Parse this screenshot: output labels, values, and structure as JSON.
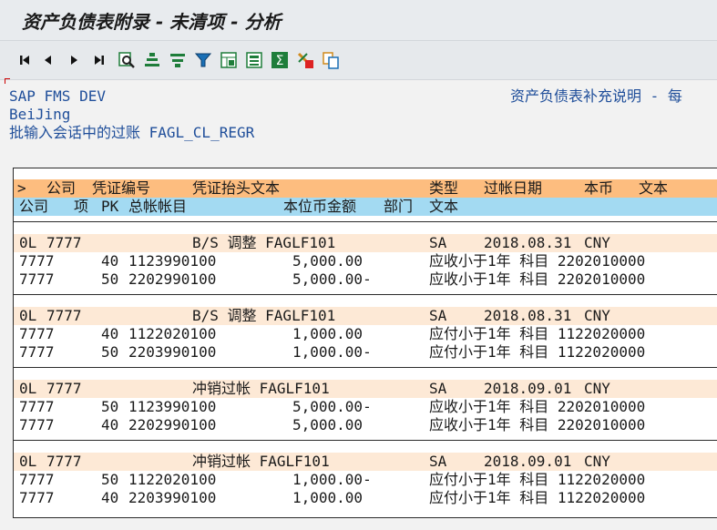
{
  "window": {
    "title": "资产负债表附录 - 未清项 - 分析"
  },
  "toolbar": {
    "buttons": [
      {
        "icon": "first-page-icon",
        "label": ""
      },
      {
        "icon": "previous-page-icon",
        "label": ""
      },
      {
        "icon": "next-page-icon",
        "label": ""
      },
      {
        "icon": "last-page-icon",
        "label": ""
      },
      {
        "icon": "find-icon",
        "label": ""
      },
      {
        "icon": "sort-ascending-icon",
        "label": ""
      },
      {
        "icon": "sort-descending-icon",
        "label": ""
      },
      {
        "icon": "filter-icon",
        "label": ""
      },
      {
        "icon": "select-layout-icon",
        "label": ""
      },
      {
        "icon": "details-icon",
        "label": ""
      },
      {
        "icon": "sum-icon",
        "label": ""
      },
      {
        "icon": "export-icon",
        "label": ""
      },
      {
        "icon": "copy-icon",
        "label": ""
      }
    ]
  },
  "header": {
    "system": "SAP FMS DEV",
    "city": "BeiJing",
    "session": "批输入会话中的过账 FAGL_CL_REGR",
    "report_title": "资产负债表补充说明 - 每"
  },
  "table": {
    "header1": {
      "arrow": ">",
      "company": "公司",
      "doc_no": "凭证编号",
      "header_text": "凭证抬头文本",
      "type": "类型",
      "post_date": "过帐日期",
      "currency": "本币",
      "text": "文本"
    },
    "header2": {
      "company": "公司",
      "item": "项",
      "pk": "PK",
      "gl": "总帐帐目",
      "amount": "本位币金额",
      "dept": "部门",
      "text": "文本"
    },
    "groups": [
      {
        "header": {
          "ledger": "0L",
          "company": "7777",
          "header_text": "B/S 调整 FAGLF101",
          "type": "SA",
          "date": "2018.08.31",
          "currency": "CNY"
        },
        "lines": [
          {
            "company": "7777",
            "pk": "40",
            "gl": "1123990100",
            "amount": "5,000.00",
            "text": "应收小于1年 科目 2202010000"
          },
          {
            "company": "7777",
            "pk": "50",
            "gl": "2202990100",
            "amount": "5,000.00-",
            "text": "应收小于1年 科目 2202010000"
          }
        ]
      },
      {
        "header": {
          "ledger": "0L",
          "company": "7777",
          "header_text": "B/S 调整 FAGLF101",
          "type": "SA",
          "date": "2018.08.31",
          "currency": "CNY"
        },
        "lines": [
          {
            "company": "7777",
            "pk": "40",
            "gl": "1122020100",
            "amount": "1,000.00",
            "text": "应付小于1年 科目 1122020000"
          },
          {
            "company": "7777",
            "pk": "50",
            "gl": "2203990100",
            "amount": "1,000.00-",
            "text": "应付小于1年 科目 1122020000"
          }
        ]
      },
      {
        "header": {
          "ledger": "0L",
          "company": "7777",
          "header_text": "冲销过帐 FAGLF101",
          "type": "SA",
          "date": "2018.09.01",
          "currency": "CNY"
        },
        "lines": [
          {
            "company": "7777",
            "pk": "50",
            "gl": "1123990100",
            "amount": "5,000.00-",
            "text": "应收小于1年 科目 2202010000"
          },
          {
            "company": "7777",
            "pk": "40",
            "gl": "2202990100",
            "amount": "5,000.00",
            "text": "应收小于1年 科目 2202010000"
          }
        ]
      },
      {
        "header": {
          "ledger": "0L",
          "company": "7777",
          "header_text": "冲销过帐 FAGLF101",
          "type": "SA",
          "date": "2018.09.01",
          "currency": "CNY"
        },
        "lines": [
          {
            "company": "7777",
            "pk": "50",
            "gl": "1122020100",
            "amount": "1,000.00-",
            "text": "应付小于1年 科目 1122020000"
          },
          {
            "company": "7777",
            "pk": "40",
            "gl": "2203990100",
            "amount": "1,000.00",
            "text": "应付小于1年 科目 1122020000"
          }
        ]
      }
    ]
  }
}
